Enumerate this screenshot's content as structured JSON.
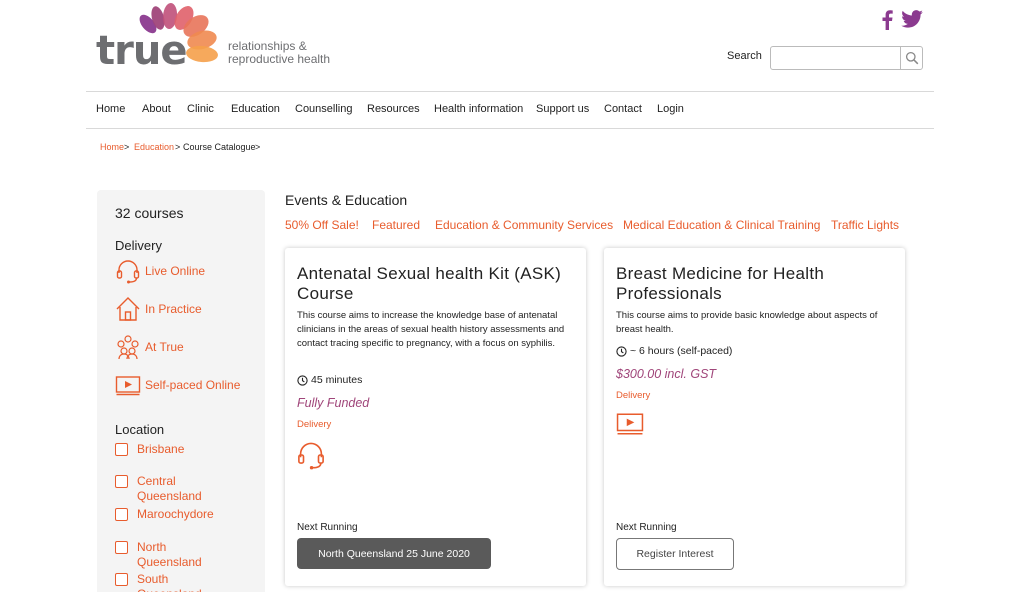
{
  "brand": {
    "logo_text": "true",
    "tagline_line1": "relationships &",
    "tagline_line2": "reproductive health",
    "colors": {
      "accent": "#e85c2d",
      "purple": "#8b3a8f",
      "price": "#a0467a",
      "logo_grey": "#6d6e71"
    }
  },
  "social": {
    "facebook_icon": "facebook-icon",
    "twitter_icon": "twitter-icon"
  },
  "search": {
    "label": "Search",
    "value": "",
    "placeholder": ""
  },
  "nav": [
    "Home",
    "About",
    "Clinic",
    "Education",
    "Counselling",
    "Resources",
    "Health information",
    "Support us",
    "Contact",
    "Login"
  ],
  "breadcrumb": {
    "home": "Home",
    "education": "Education",
    "current": "Course Catalogue",
    "separator": ">"
  },
  "sidebar": {
    "count": "32 courses",
    "delivery_heading": "Delivery",
    "delivery": [
      {
        "label": "Live Online",
        "icon": "headset-icon"
      },
      {
        "label": "In Practice",
        "icon": "house-icon"
      },
      {
        "label": "At True",
        "icon": "group-icon"
      },
      {
        "label": "Self-paced Online",
        "icon": "monitor-play-icon"
      }
    ],
    "location_heading": "Location",
    "locations": [
      "Brisbane",
      "Central Queensland",
      "Maroochydore",
      "North Queensland",
      "South Queensland"
    ]
  },
  "main": {
    "title": "Events & Education",
    "categories": [
      "50% Off Sale!",
      "Featured",
      "Education & Community Services",
      "Medical Education & Clinical Training",
      "Traffic Lights"
    ]
  },
  "cards": [
    {
      "title": "Antenatal Sexual health Kit (ASK) Course",
      "description": "This course aims to increase the knowledge base of antenatal clinicians in the areas of sexual health history assessments and contact tracing specific to pregnancy, with a focus on syphilis.",
      "duration": "45 minutes",
      "price": "Fully Funded",
      "delivery_label": "Delivery",
      "delivery_icon": "headset-icon",
      "next_label": "Next Running",
      "button": "North Queensland 25 June 2020"
    },
    {
      "title": "Breast Medicine for Health Professionals",
      "description": "This course aims to provide basic knowledge about aspects of breast health.",
      "duration": "~ 6 hours (self-paced)",
      "price": "$300.00 incl. GST",
      "delivery_label": "Delivery",
      "delivery_icon": "monitor-play-icon",
      "next_label": "Next Running",
      "button": "Register Interest"
    }
  ]
}
